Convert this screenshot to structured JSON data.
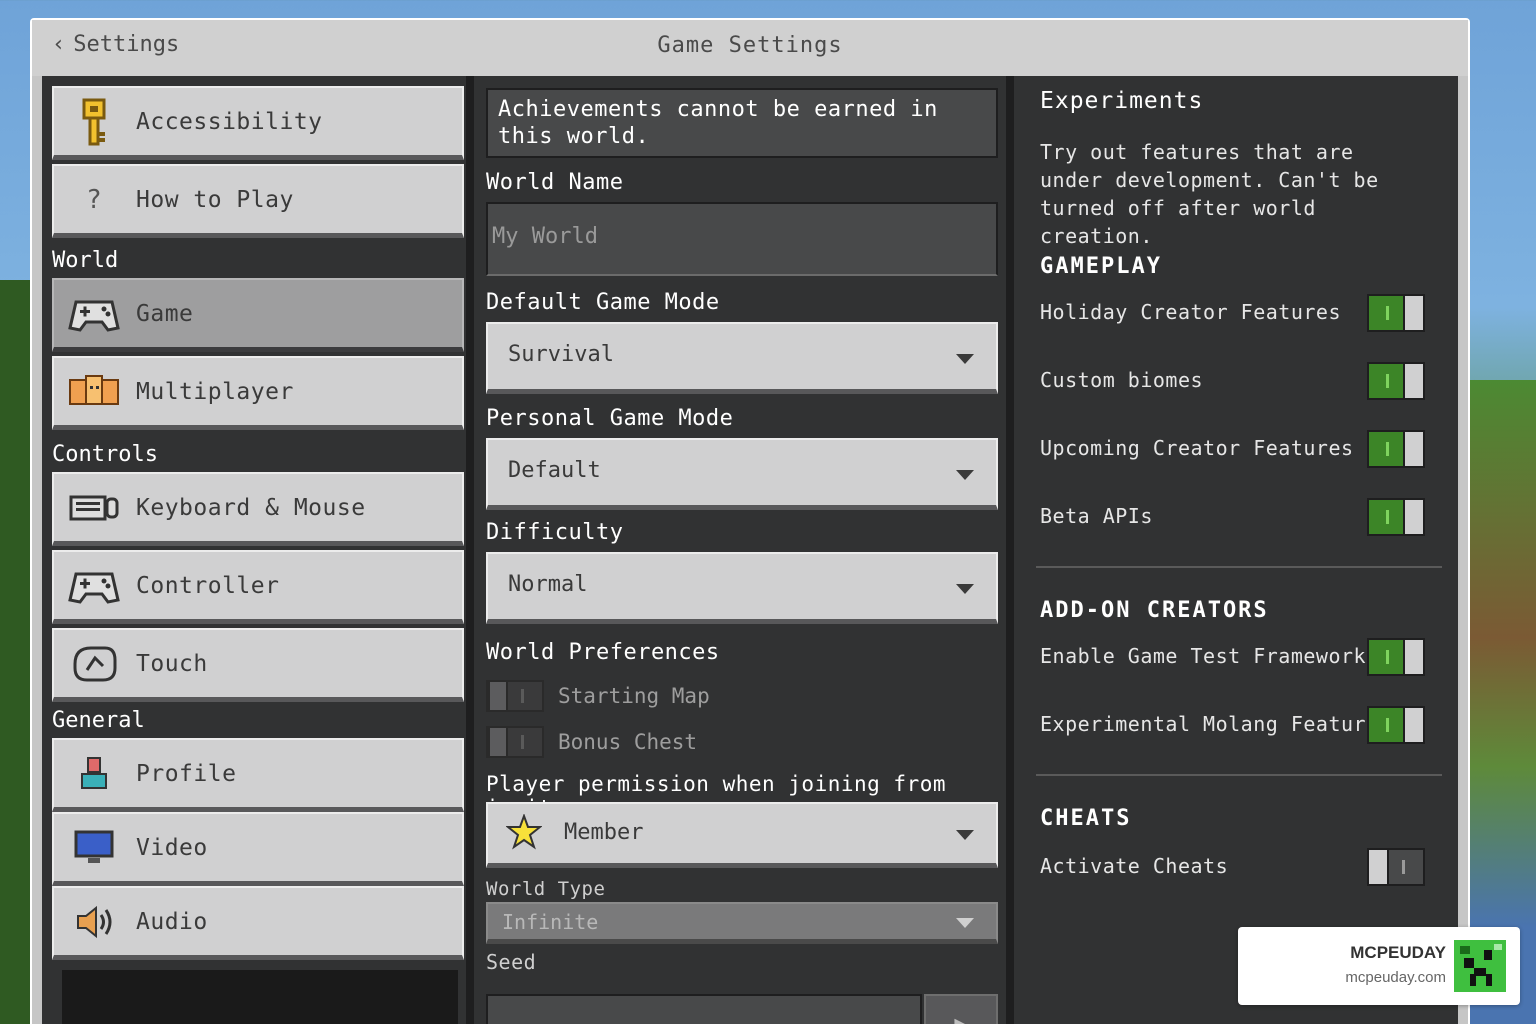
{
  "header": {
    "back_label": "Settings",
    "title": "Game Settings"
  },
  "sidebar": {
    "top_items": [
      {
        "label": "Accessibility",
        "icon": "key-icon"
      },
      {
        "label": "How to Play",
        "icon": "question-icon"
      }
    ],
    "sections": [
      {
        "title": "World",
        "items": [
          {
            "label": "Game",
            "icon": "gamepad-icon",
            "active": true
          },
          {
            "label": "Multiplayer",
            "icon": "multiplayer-icon"
          }
        ]
      },
      {
        "title": "Controls",
        "items": [
          {
            "label": "Keyboard & Mouse",
            "icon": "keyboard-icon"
          },
          {
            "label": "Controller",
            "icon": "controller-icon"
          },
          {
            "label": "Touch",
            "icon": "touch-icon"
          }
        ]
      },
      {
        "title": "General",
        "items": [
          {
            "label": "Profile",
            "icon": "profile-icon"
          },
          {
            "label": "Video",
            "icon": "monitor-icon"
          },
          {
            "label": "Audio",
            "icon": "speaker-icon"
          }
        ]
      }
    ]
  },
  "game": {
    "notice": "Achievements cannot be earned in this world.",
    "world_name_label": "World Name",
    "world_name_value": "My World",
    "default_game_mode_label": "Default Game Mode",
    "default_game_mode_value": "Survival",
    "personal_game_mode_label": "Personal Game Mode",
    "personal_game_mode_value": "Default",
    "difficulty_label": "Difficulty",
    "difficulty_value": "Normal",
    "world_preferences_label": "World Preferences",
    "starting_map_label": "Starting Map",
    "bonus_chest_label": "Bonus Chest",
    "player_permission_label": "Player permission when joining from invite",
    "player_permission_value": "Member",
    "world_type_label": "World Type",
    "world_type_value": "Infinite",
    "seed_label": "Seed"
  },
  "experiments": {
    "title": "Experiments",
    "description": "Try out features that are under development. Can't be turned off after world creation.",
    "gameplay_heading": "GAMEPLAY",
    "gameplay_items": [
      {
        "label": "Holiday Creator Features",
        "on": true
      },
      {
        "label": "Custom biomes",
        "on": true
      },
      {
        "label": "Upcoming Creator Features",
        "on": true
      },
      {
        "label": "Beta APIs",
        "on": true
      }
    ],
    "addon_heading": "ADD-ON CREATORS",
    "addon_items": [
      {
        "label": "Enable Game Test Framework",
        "on": true
      },
      {
        "label": "Experimental Molang Features",
        "on": true
      }
    ],
    "cheats_heading": "CHEATS",
    "cheats_items": [
      {
        "label": "Activate Cheats",
        "on": false
      }
    ]
  },
  "watermark": {
    "name": "MCPEUDAY",
    "url": "mcpeuday.com"
  },
  "colors": {
    "toggle_on": "#3c8527",
    "panel": "#313233",
    "button": "#d0d0d1"
  }
}
